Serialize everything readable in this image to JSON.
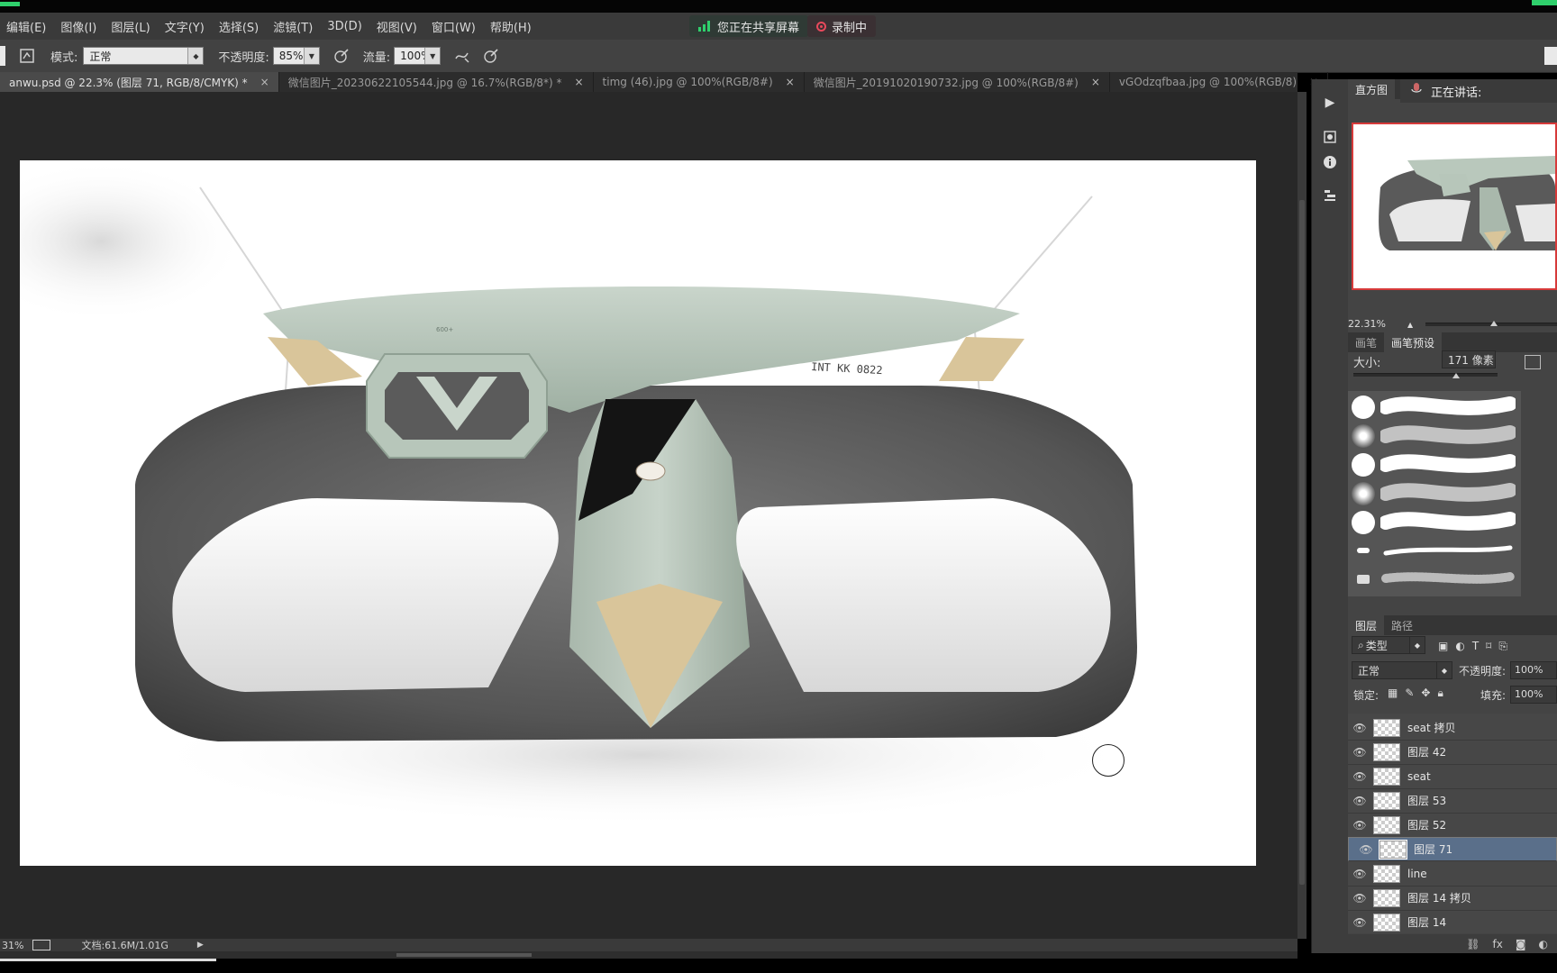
{
  "menubar": {
    "items": [
      "编辑(E)",
      "图像(I)",
      "图层(L)",
      "文字(Y)",
      "选择(S)",
      "滤镜(T)",
      "3D(D)",
      "视图(V)",
      "窗口(W)",
      "帮助(H)"
    ],
    "share_text": "您正在共享屏幕",
    "record_text": "录制中"
  },
  "options": {
    "mode_label": "模式:",
    "mode_value": "正常",
    "opacity_label": "不透明度:",
    "opacity_value": "85%",
    "flow_label": "流量:",
    "flow_value": "100%"
  },
  "tabs": [
    {
      "label": "anwu.psd @ 22.3% (图层 71, RGB/8/CMYK) *",
      "active": true
    },
    {
      "label": "微信图片_20230622105544.jpg @ 16.7%(RGB/8*) *",
      "active": false
    },
    {
      "label": "timg (46).jpg @ 100%(RGB/8#)",
      "active": false
    },
    {
      "label": "微信图片_20191020190732.jpg @ 100%(RGB/8#)",
      "active": false
    },
    {
      "label": "vGOdzqfbaa.jpg @ 100%(RGB/8)",
      "active": false
    }
  ],
  "tab_close": "×",
  "artwork": {
    "sketch_label": "INT KK 0822",
    "screen_text": "600+"
  },
  "status": {
    "zoom": "31%",
    "doc_label": "文档:61.6M/1.01G"
  },
  "panel": {
    "top_tab": "直方图",
    "speaking": "正在讲话:",
    "zoom_value": "22.31%",
    "brush_tabs": [
      "画笔",
      "画笔预设"
    ],
    "size_label": "大小:",
    "size_value": "171 像素",
    "layer_tabs": [
      "图层",
      "路径"
    ],
    "filter_value": "类型",
    "blend_value": "正常",
    "opacity_label": "不透明度:",
    "opacity_value": "100%",
    "lock_label": "锁定:",
    "fill_label": "填充:",
    "fill_value": "100%",
    "layers": [
      {
        "name": "seat 拷贝",
        "selected": false
      },
      {
        "name": "图层 42",
        "selected": false
      },
      {
        "name": "seat",
        "selected": false
      },
      {
        "name": "图层 53",
        "selected": false
      },
      {
        "name": "图层 52",
        "selected": false
      },
      {
        "name": "图层 71",
        "selected": true
      },
      {
        "name": "line",
        "selected": false
      },
      {
        "name": "图层 14 拷贝",
        "selected": false
      },
      {
        "name": "图层 14",
        "selected": false
      }
    ]
  },
  "colors": {
    "accent_green": "#2fd06c",
    "record_red": "#e8495c",
    "selected_layer": "#5a6f8a",
    "sage": "#b9c8bc",
    "tan": "#d9c59a"
  }
}
